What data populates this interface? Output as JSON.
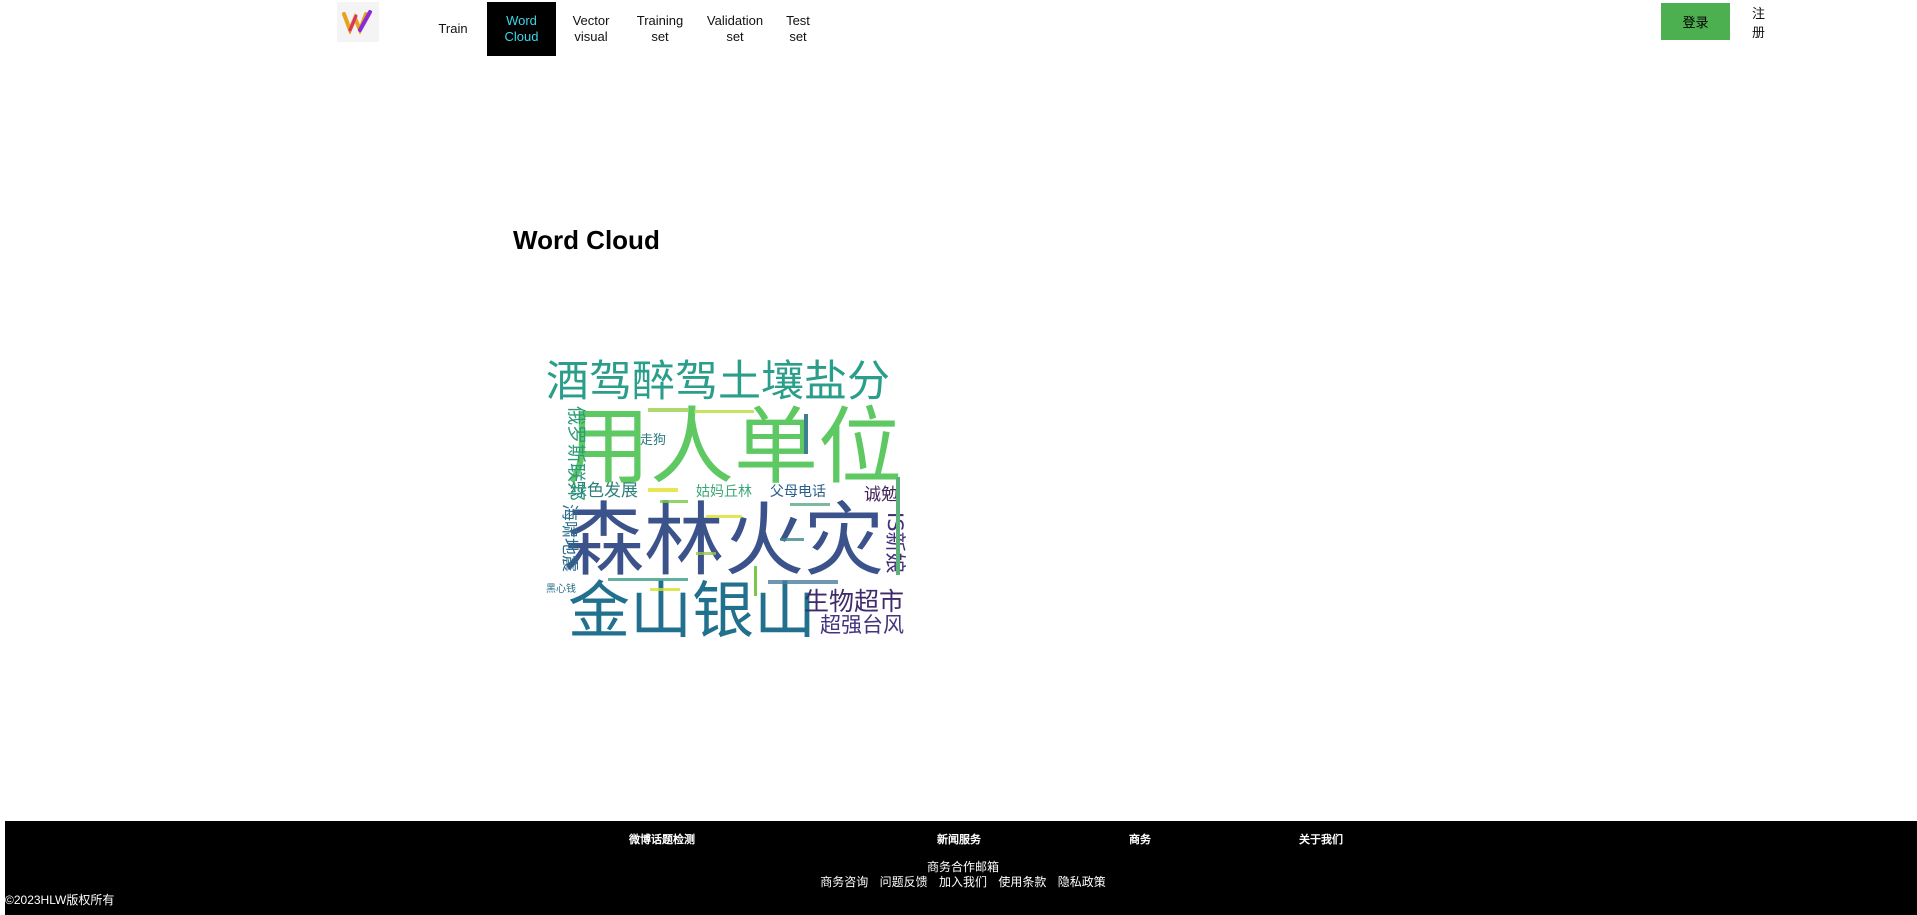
{
  "nav": {
    "items": [
      {
        "label": "Train",
        "active": false
      },
      {
        "label": "Word\nCloud",
        "active": true
      },
      {
        "label": "Vector\nvisual",
        "active": false
      },
      {
        "label": "Training\nset",
        "active": false
      },
      {
        "label": "Validation\nset",
        "active": false
      },
      {
        "label": "Test set",
        "active": false
      }
    ],
    "login_label": "登录",
    "register_label": "注册"
  },
  "main": {
    "title": "Word Cloud",
    "cloud_words": [
      "用人单位",
      "森林火灾",
      "金山银山",
      "酒驾醉驾土壤盐分",
      "俄罗斯联邦",
      "海啸地震",
      "绿色发展",
      "姑妈丘林",
      "父母电话",
      "诚勉",
      "IS新娘",
      "生物超市",
      "超强台风",
      "走狗",
      "黑心钱"
    ]
  },
  "footer": {
    "links": [
      "微博话题检测",
      "新闻服务",
      "商务",
      "关于我们"
    ],
    "mail": "商务合作邮箱",
    "row2": [
      "商务咨询",
      "问题反馈",
      "加入我们",
      "使用条款",
      "隐私政策"
    ],
    "copyright": "©2023HLW版权所有"
  },
  "colors": {
    "accent": "#3ad7e8",
    "login": "#4caf50"
  }
}
